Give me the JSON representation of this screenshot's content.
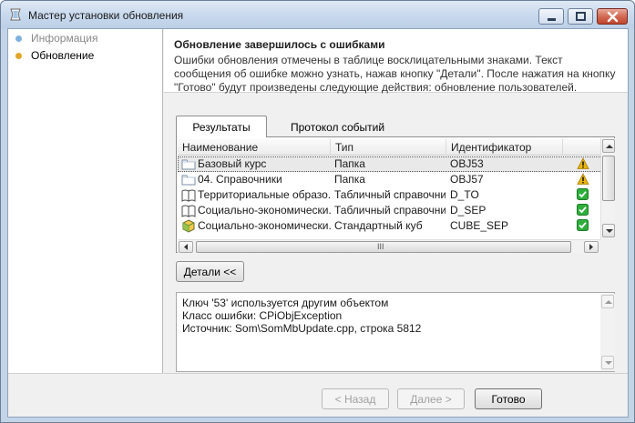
{
  "window": {
    "title": "Мастер установки обновления"
  },
  "sidebar": {
    "steps": [
      {
        "label": "Информация",
        "state": "done"
      },
      {
        "label": "Обновление",
        "state": "current"
      }
    ]
  },
  "header": {
    "title": "Обновление завершилось с ошибками",
    "description": "Ошибки обновления отмечены в таблице восклицательными знаками. Текст сообщения об ошибке можно узнать, нажав кнопку \"Детали\". После нажатия на кнопку \"Готово\" будут произведены следующие действия: обновление пользователей."
  },
  "tabs": [
    {
      "label": "Результаты",
      "active": true
    },
    {
      "label": "Протокол событий",
      "active": false
    }
  ],
  "grid": {
    "columns": [
      "Наименование",
      "Тип",
      "Идентификатор",
      ""
    ],
    "rows": [
      {
        "icon": "folder-icon",
        "name": "Базовый курс",
        "type": "Папка",
        "id": "OBJ53",
        "status": "warning"
      },
      {
        "icon": "folder-icon",
        "name": "04. Справочники",
        "type": "Папка",
        "id": "OBJ57",
        "status": "warning"
      },
      {
        "icon": "book-icon",
        "name": "Территориальные образо...",
        "type": "Табличный справочник",
        "id": "D_TO",
        "status": "ok"
      },
      {
        "icon": "book-icon",
        "name": "Социально-экономически...",
        "type": "Табличный справочник",
        "id": "D_SEP",
        "status": "ok"
      },
      {
        "icon": "cube-icon",
        "name": "Социально-экономически...",
        "type": "Стандартный куб",
        "id": "CUBE_SEP",
        "status": "ok"
      }
    ],
    "selected_row": 0,
    "hscroll_grip": "III"
  },
  "details_button": "Детали <<",
  "error_details": {
    "lines": [
      "Ключ '53' используется другим объектом",
      "Класс ошибки: CPiObjException",
      "Источник: Som\\SomMbUpdate.cpp, строка 5812"
    ]
  },
  "footer": {
    "back": "< Назад",
    "next": "Далее >",
    "done": "Готово"
  },
  "colors": {
    "warning": "#e8b40f",
    "ok": "#2fae3c",
    "current_step": "#e0a52a",
    "done_step": "#7fb1e0"
  }
}
